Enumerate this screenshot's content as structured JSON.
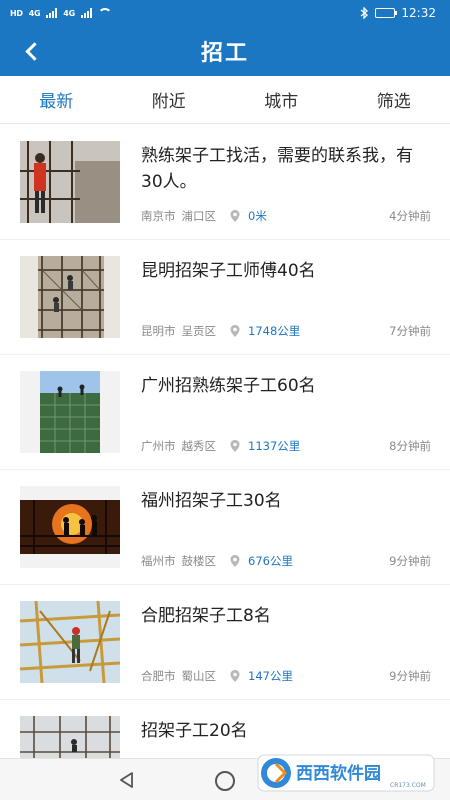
{
  "status_bar": {
    "hd_badge": "HD",
    "net1": "4G",
    "net2": "4G",
    "time": "12:32"
  },
  "header": {
    "title": "招工"
  },
  "tabs": [
    {
      "label": "最新",
      "active": true
    },
    {
      "label": "附近",
      "active": false
    },
    {
      "label": "城市",
      "active": false
    },
    {
      "label": "筛选",
      "active": false
    }
  ],
  "jobs": [
    {
      "title": "熟练架子工找活，需要的联系我，有30人。",
      "city": "南京市",
      "district": "浦口区",
      "distance": "0米",
      "time_ago": "4分钟前",
      "image": "worker-red-scaffold-photo"
    },
    {
      "title": "昆明招架子工师傅40名",
      "city": "昆明市",
      "district": "呈贡区",
      "distance": "1748公里",
      "time_ago": "7分钟前",
      "image": "scaffold-workers-photo"
    },
    {
      "title": "广州招熟练架子工60名",
      "city": "广州市",
      "district": "越秀区",
      "distance": "1137公里",
      "time_ago": "8分钟前",
      "image": "green-net-building-photo"
    },
    {
      "title": "福州招架子工30名",
      "city": "福州市",
      "district": "鼓楼区",
      "distance": "676公里",
      "time_ago": "9分钟前",
      "image": "sunset-silhouette-photo"
    },
    {
      "title": "合肥招架子工8名",
      "city": "合肥市",
      "district": "蜀山区",
      "distance": "147公里",
      "time_ago": "9分钟前",
      "image": "bamboo-scaffold-photo"
    },
    {
      "title": "招架子工20名",
      "image": "tower-scaffold-photo"
    }
  ],
  "watermark": {
    "text": "西西软件园",
    "domain": "CR173.COM"
  },
  "colors": {
    "primary": "#1c77c3",
    "meta_gray": "#8a8a8a"
  }
}
